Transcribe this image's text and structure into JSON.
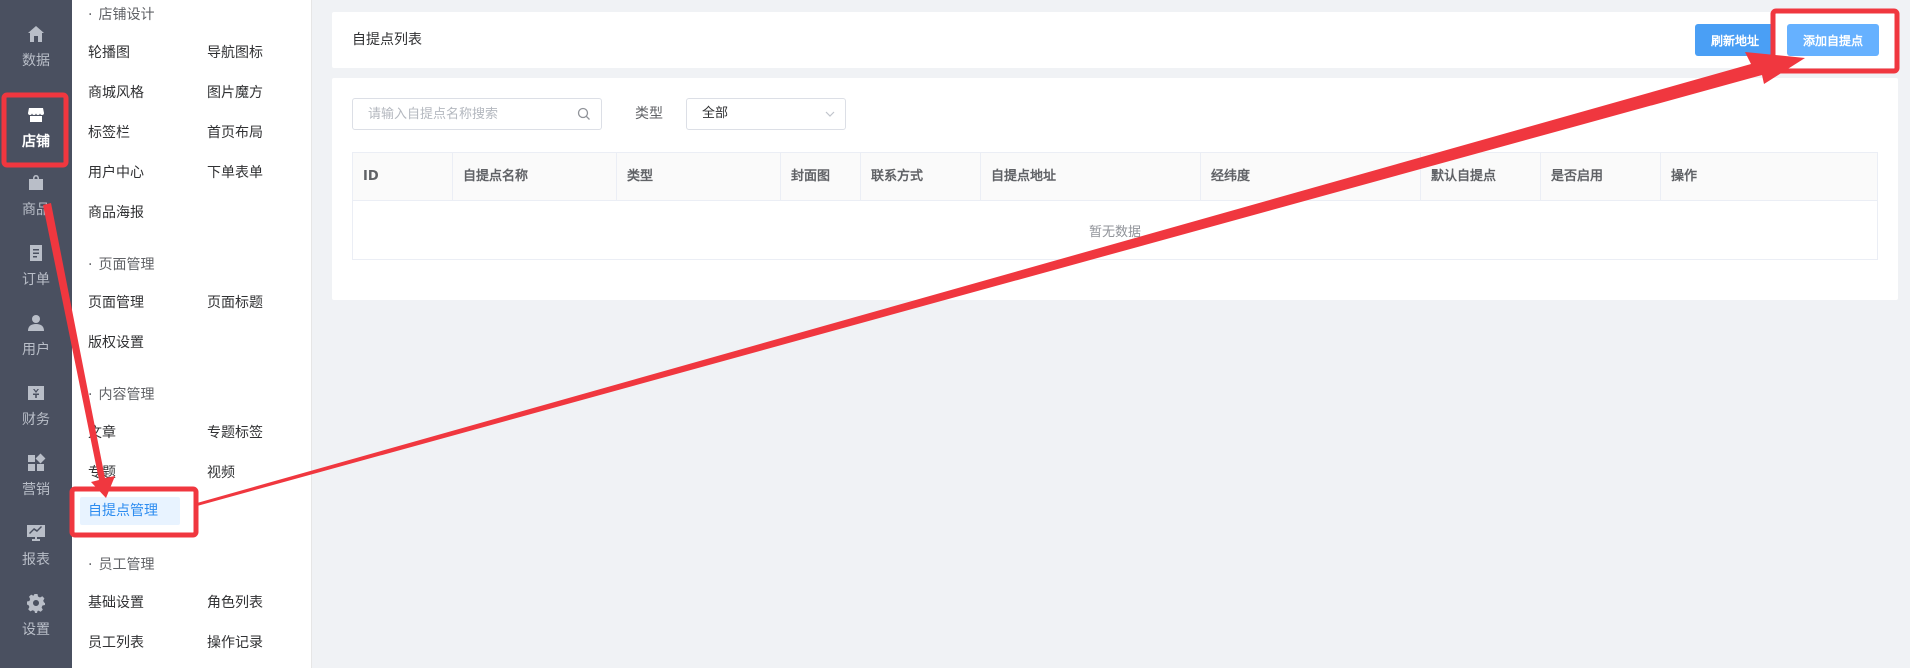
{
  "rail": {
    "items": [
      {
        "label": "数据",
        "icon": "home-icon"
      },
      {
        "label": "店铺",
        "icon": "store-icon",
        "active": true
      },
      {
        "label": "商品",
        "icon": "goods-icon"
      },
      {
        "label": "订单",
        "icon": "order-icon"
      },
      {
        "label": "用户",
        "icon": "user-icon"
      },
      {
        "label": "财务",
        "icon": "finance-icon"
      },
      {
        "label": "营销",
        "icon": "marketing-icon"
      },
      {
        "label": "报表",
        "icon": "report-icon"
      },
      {
        "label": "设置",
        "icon": "settings-icon"
      }
    ]
  },
  "submenu": {
    "groups": [
      {
        "title": "店铺设计",
        "links": [
          "轮播图",
          "导航图标",
          "商城风格",
          "图片魔方",
          "标签栏",
          "首页布局",
          "用户中心",
          "下单表单",
          "商品海报"
        ]
      },
      {
        "title": "页面管理",
        "links": [
          "页面管理",
          "页面标题",
          "版权设置"
        ]
      },
      {
        "title": "内容管理",
        "links": [
          "文章",
          "专题标签",
          "专题",
          "视频",
          "自提点管理"
        ]
      },
      {
        "title": "员工管理",
        "links": [
          "基础设置",
          "角色列表",
          "员工列表",
          "操作记录"
        ]
      }
    ],
    "active_link": "自提点管理"
  },
  "header": {
    "title": "自提点列表",
    "refresh_label": "刷新地址",
    "add_label": "添加自提点"
  },
  "filters": {
    "search_placeholder": "请输入自提点名称搜索",
    "type_label": "类型",
    "type_value": "全部"
  },
  "table": {
    "columns": [
      "ID",
      "自提点名称",
      "类型",
      "封面图",
      "联系方式",
      "自提点地址",
      "经纬度",
      "默认自提点",
      "是否启用",
      "操作"
    ],
    "empty_text": "暂无数据"
  },
  "colors": {
    "rail_bg": "#4a5060",
    "primary": "#4a9ff5",
    "annotation": "#f0373f"
  }
}
